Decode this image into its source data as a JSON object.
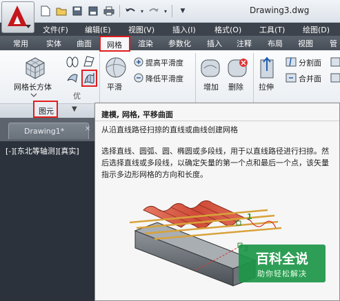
{
  "window": {
    "title": "Drawing3.dwg"
  },
  "quick_access": {
    "icons": [
      "new-icon",
      "open-icon",
      "save-icon",
      "save-as-icon",
      "print-icon",
      "undo-icon",
      "redo-icon"
    ],
    "more": "▼"
  },
  "menu": [
    "文件(F)",
    "编辑(E)",
    "视图(V)",
    "插入(I)",
    "格式(O)",
    "工具(T)",
    "绘图(D)"
  ],
  "ribbon_tabs": [
    "常用",
    "实体",
    "曲面",
    "网格",
    "渲染",
    "参数化",
    "插入",
    "注释",
    "布局",
    "视图",
    "管"
  ],
  "ribbon": {
    "active_tab": "网格",
    "mesh_box_label": "网格长方体",
    "smooth_label": "平滑",
    "smooth_more": "提高平滑度",
    "smooth_less": "降低平滑度",
    "add_label": "增加",
    "delete_label": "删除",
    "stretch_label": "拉伸",
    "split_face": "分割面",
    "merge_face": "合并面",
    "panel_label": "图元",
    "expand": "▼",
    "small_label_truncated": "优"
  },
  "document": {
    "tab_label": "Drawing1*",
    "viewport_label": "[-][东北等轴测][真实]"
  },
  "tooltip": {
    "title": "建模, 网格, 平移曲面",
    "summary": "从沿直线路径扫掠的直线或曲线创建网格",
    "description": "选择直线、圆弧、圆、椭圆或多段线，用于以直线路径进行扫掠。然后选择直线或多段线，以确定矢量的第一个点和最后一个点，该矢量指示多边形网格的方向和长度。",
    "callout_1": "1",
    "callout_2": "2"
  },
  "watermark": {
    "main": "百科全说",
    "sub": "助你轻松解决"
  },
  "colors": {
    "accent_red": "#e21c1c",
    "menu_bar": "#3d434c",
    "ribbon_tabs": "#4f5660",
    "canvas": "#2b323b",
    "mesh_surface": "#d3543f",
    "watermark_green": "#1c9648"
  }
}
